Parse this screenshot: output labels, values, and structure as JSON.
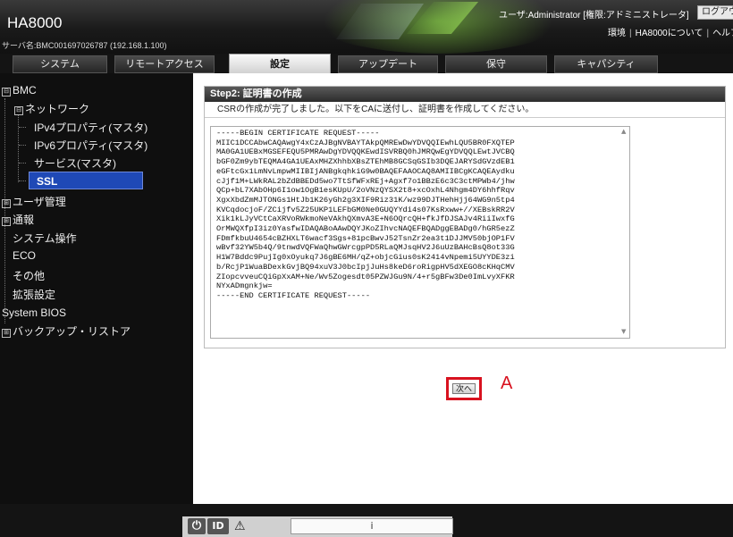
{
  "header": {
    "brand": "HA8000",
    "server_name": "サーバ名:BMC001697026787 (192.168.1.100)",
    "user_info": "ユーザ:Administrator [権限:アドミニストレータ]",
    "logout_label": "ログアウト",
    "links": [
      "環境",
      "HA8000について",
      "ヘルプ"
    ]
  },
  "tabs": [
    {
      "label": "システム"
    },
    {
      "label": "リモートアクセス"
    },
    {
      "label": "設定",
      "active": true
    },
    {
      "label": "アップデート"
    },
    {
      "label": "保守"
    },
    {
      "label": "キャパシティ"
    }
  ],
  "sidebar": {
    "items": [
      {
        "label": "BMC",
        "toggle": "⊟"
      },
      {
        "label": "ネットワーク",
        "toggle": "⊟"
      },
      {
        "label": "IPv4プロパティ(マスタ)"
      },
      {
        "label": "IPv6プロパティ(マスタ)"
      },
      {
        "label": "サービス(マスタ)"
      },
      {
        "label": "SSL",
        "selected": true
      },
      {
        "label": "ユーザ管理",
        "toggle": "⊞"
      },
      {
        "label": "通報",
        "toggle": "⊞"
      },
      {
        "label": "システム操作"
      },
      {
        "label": "ECO"
      },
      {
        "label": "その他"
      },
      {
        "label": "拡張設定"
      },
      {
        "label": "System BIOS"
      },
      {
        "label": "バックアップ・リストア",
        "toggle": "⊞"
      }
    ]
  },
  "main": {
    "step_title": "Step2: 証明書の作成",
    "message": "CSRの作成が完了しました。以下をCAに送付し、証明書を作成してください。",
    "csr_text": "-----BEGIN CERTIFICATE REQUEST-----\nMIIC1DCCAbwCAQAwgY4xCzAJBgNVBAYTAkpQMREwDwYDVQQIEwhLQU5BR0FXQTEP\nMA0GA1UEBxMGSEFEQU5PMRAwDgYDVQQKEwdISVRBQ0hJMRQwEgYDVQQLEwtJVCBQ\nbGF0Zm9ybTEQMA4GA1UEAxMHZXhhbXBsZTEhMB8GCSqGSIb3DQEJARYSdGVzdEB1\neGFtcGx1LmNvLmpwMIIBIjANBgkqhkiG9w0BAQEFAAOCAQ8AMIIBCgKCAQEAydku\ncJjf1M+LWkRAL2bZdBBEDd5wo7TtSfWFxREj+Agxf7o1BBzE6c3C3ctMPWb4/jhw\nQCp+bL7XAbOHp6I1ow1OgB1esKUpU/2oVNzQYSX2t8+xcOxhL4Nhgm4DY6hhfRqv\nXgxXbdZmMJTONGs1HtJb1K26yGh2g3XIF9Riz31K/wz99DJTHehHjj64WG9n5tp4\nKVCqdocjoF/ZCijfv5Z25UKP1LEFbGM0Ne0GUQYYdi4s07KsRxww+//XEBskRR2V\nXik1kLJyVCtCaXRVoRWkmoNeVAkhQXmvA3E+N6OQrcQH+fkJfDJSAJv4RiiIwxfG\nOrMWQXfpI3iz0YasfwIDAQABoAAwDQYJKoZIhvcNAQEFBQADggEBADg0/hGR5ezZ\nFDmfkbuU4654cBZHXLT6wacf3Sgs+81pcBwvJ52TsnZr2ea3t1DJJMV50bjOP1FV\nwBvf32YW5b4Q/9tnwdVQFWaQhwGWrcgpPD5RLaQMJsqHV2J6uUzBAHcBsQ8ot33G\nH1W7Bddc9PujIg0xOyukq7J6gBE6MH/qZ+objcGius0sK2414vNpemi5UYYDE3zi\nb/RcjP1WuaBDexkGvjBQ94xuV3J0bcIpjJuHs8keD6roRigpHV5dXEGO8cKHqCMV\nZIopcvveuCQiGpXxAM+Ne/Wv5Zogesdt05PZWJGu9N/4+r5gBFw3De0ImLvyXFKR\nNYxADmgnkjw=\n-----END CERTIFICATE REQUEST-----",
    "next_label": "次へ",
    "callout_label": "A"
  },
  "footer": {
    "power_icon": "power-icon",
    "id_label": "ID",
    "alert_icon": "warning-icon",
    "status_symbol": "i"
  },
  "colors": {
    "accent_selected": "#1f49b6",
    "highlight": "#d8121f"
  }
}
